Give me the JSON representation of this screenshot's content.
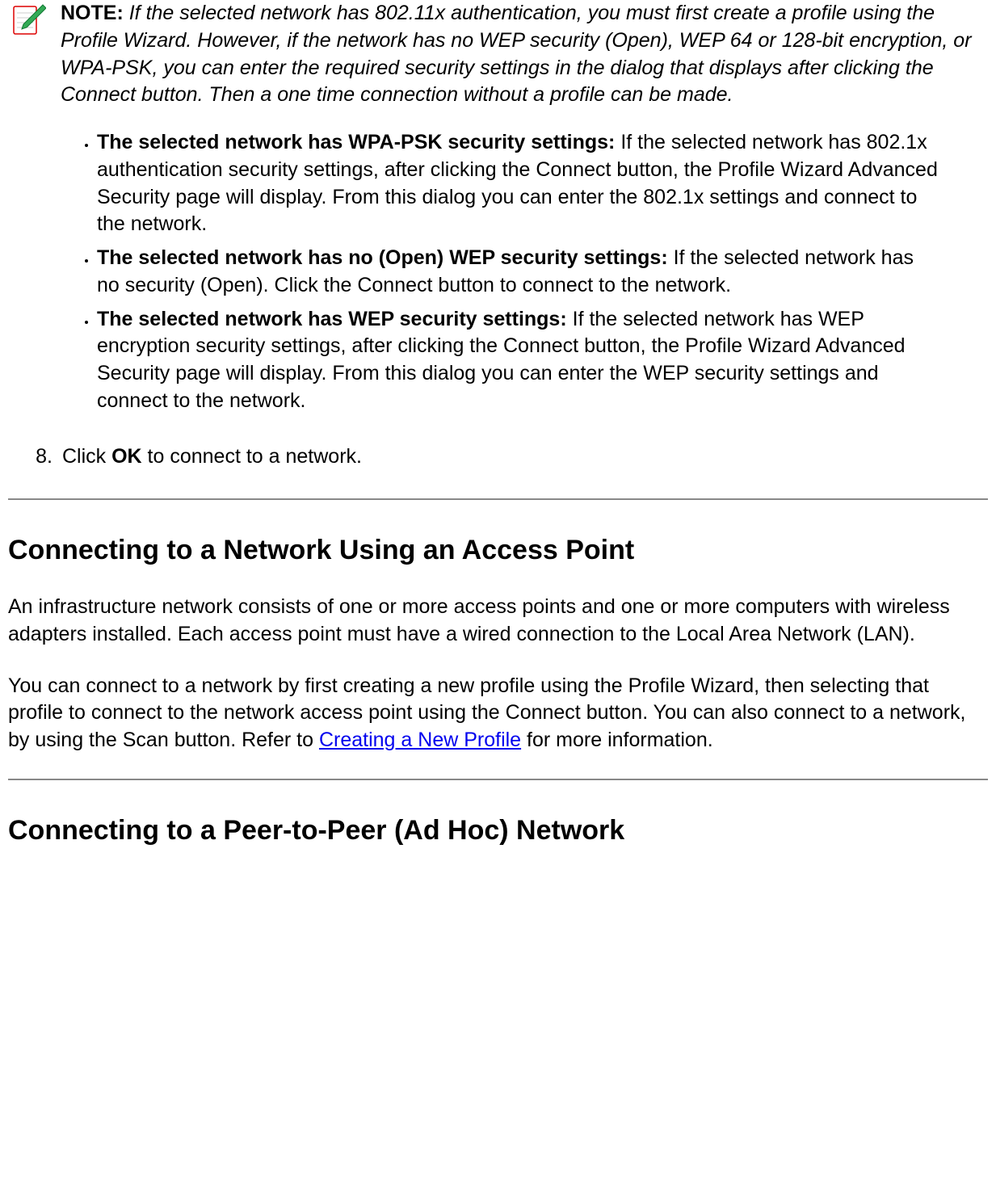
{
  "note": {
    "label": "NOTE:",
    "body": "If the selected network has 802.11x authentication, you must first create a profile using the Profile Wizard. However, if the network has no WEP security (Open), WEP 64 or 128-bit encryption, or WPA-PSK, you can enter the required security settings in the dialog that displays after clicking the Connect button. Then a one time connection without a profile can be made."
  },
  "bullets": [
    {
      "title": "The selected network has WPA-PSK security settings:",
      "text": " If the selected network has 802.1x authentication security settings, after clicking the Connect button, the Profile Wizard Advanced Security page will display. From this dialog you can enter the 802.1x settings and connect to the network."
    },
    {
      "title": "The selected network has no (Open) WEP security settings:",
      "text": "  If the selected network has no security (Open). Click the Connect button to connect to the network."
    },
    {
      "title": "The selected network has WEP security settings:",
      "text": " If the selected network has WEP encryption security settings, after clicking the Connect button, the Profile Wizard Advanced Security page will display. From this dialog you can enter the WEP security settings and connect to the network."
    }
  ],
  "step8": {
    "number": "8.",
    "pre": "Click ",
    "bold": "OK",
    "post": " to connect to a network."
  },
  "section_ap": {
    "heading": "Connecting to a Network Using an Access Point",
    "para1": "An infrastructure network consists of one or more access points and one or more computers with wireless adapters installed. Each access point must have a wired connection to the Local Area Network (LAN).",
    "para2_pre": "You can connect to a network by first creating a new profile using the Profile Wizard, then selecting that profile to connect to the network access point using the Connect button. You can also connect to a network, by using the Scan button. Refer to ",
    "para2_link": "Creating a New Profile",
    "para2_post": " for more information."
  },
  "section_adhoc": {
    "heading": "Connecting to a Peer-to-Peer (Ad Hoc) Network"
  }
}
